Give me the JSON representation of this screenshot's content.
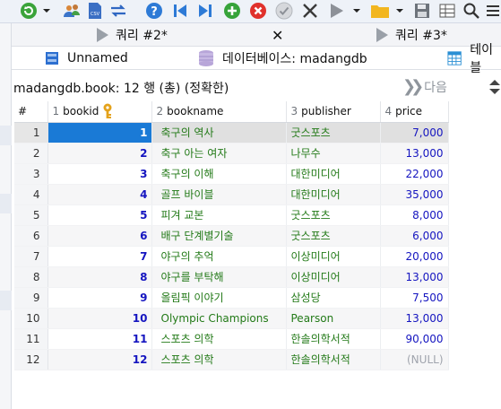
{
  "toolbar": {
    "icons": [
      "refresh-icon",
      "users-icon",
      "csv-icon",
      "swap-icon",
      "help-icon",
      "first-icon",
      "last-icon",
      "add-icon",
      "delete-icon",
      "check-icon",
      "cancel-icon",
      "play-icon",
      "folder-icon",
      "save-icon",
      "grid-icon",
      "search-icon",
      "list-icon"
    ]
  },
  "query_tabs": [
    {
      "label": "쿼리 #2*",
      "close": "✕"
    },
    {
      "label": "쿼리 #3*"
    }
  ],
  "object_tabs": [
    {
      "label": "Unnamed"
    },
    {
      "label": "데이터베이스: madangdb"
    },
    {
      "label": "테이블"
    }
  ],
  "info": {
    "rows_text": "madangdb.book: 12 행 (총) (정확한)",
    "next_label": "다음"
  },
  "grid": {
    "corner": "#",
    "columns": [
      {
        "num": "1",
        "name": "bookid"
      },
      {
        "num": "2",
        "name": "bookname"
      },
      {
        "num": "3",
        "name": "publisher"
      },
      {
        "num": "4",
        "name": "price"
      }
    ],
    "rows": [
      {
        "n": "1",
        "bookid": "1",
        "bookname": "축구의 역사",
        "publisher": "굿스포츠",
        "price": "7,000"
      },
      {
        "n": "2",
        "bookid": "2",
        "bookname": "축구 아는 여자",
        "publisher": "나무수",
        "price": "13,000"
      },
      {
        "n": "3",
        "bookid": "3",
        "bookname": "축구의 이해",
        "publisher": "대한미디어",
        "price": "22,000"
      },
      {
        "n": "4",
        "bookid": "4",
        "bookname": "골프 바이블",
        "publisher": "대한미디어",
        "price": "35,000"
      },
      {
        "n": "5",
        "bookid": "5",
        "bookname": "피겨 교본",
        "publisher": "굿스포츠",
        "price": "8,000"
      },
      {
        "n": "6",
        "bookid": "6",
        "bookname": "배구 단계별기술",
        "publisher": "굿스포츠",
        "price": "6,000"
      },
      {
        "n": "7",
        "bookid": "7",
        "bookname": "야구의 추억",
        "publisher": "이상미디어",
        "price": "20,000"
      },
      {
        "n": "8",
        "bookid": "8",
        "bookname": "야구를 부탁해",
        "publisher": "이상미디어",
        "price": "13,000"
      },
      {
        "n": "9",
        "bookid": "9",
        "bookname": "올림픽 이야기",
        "publisher": "삼성당",
        "price": "7,500"
      },
      {
        "n": "10",
        "bookid": "10",
        "bookname": "Olympic Champions",
        "publisher": "Pearson",
        "price": "13,000"
      },
      {
        "n": "11",
        "bookid": "11",
        "bookname": "스포츠 의학",
        "publisher": "한솔의학서적",
        "price": "90,000"
      },
      {
        "n": "12",
        "bookid": "12",
        "bookname": "스포츠 의학",
        "publisher": "한솔의학서적",
        "price": "(NULL)"
      }
    ]
  },
  "colors": {
    "accent_selected": "#1a7ad6",
    "id_text": "#1515c0",
    "text_green": "#237a18",
    "null_gray": "#a0a4ad"
  }
}
